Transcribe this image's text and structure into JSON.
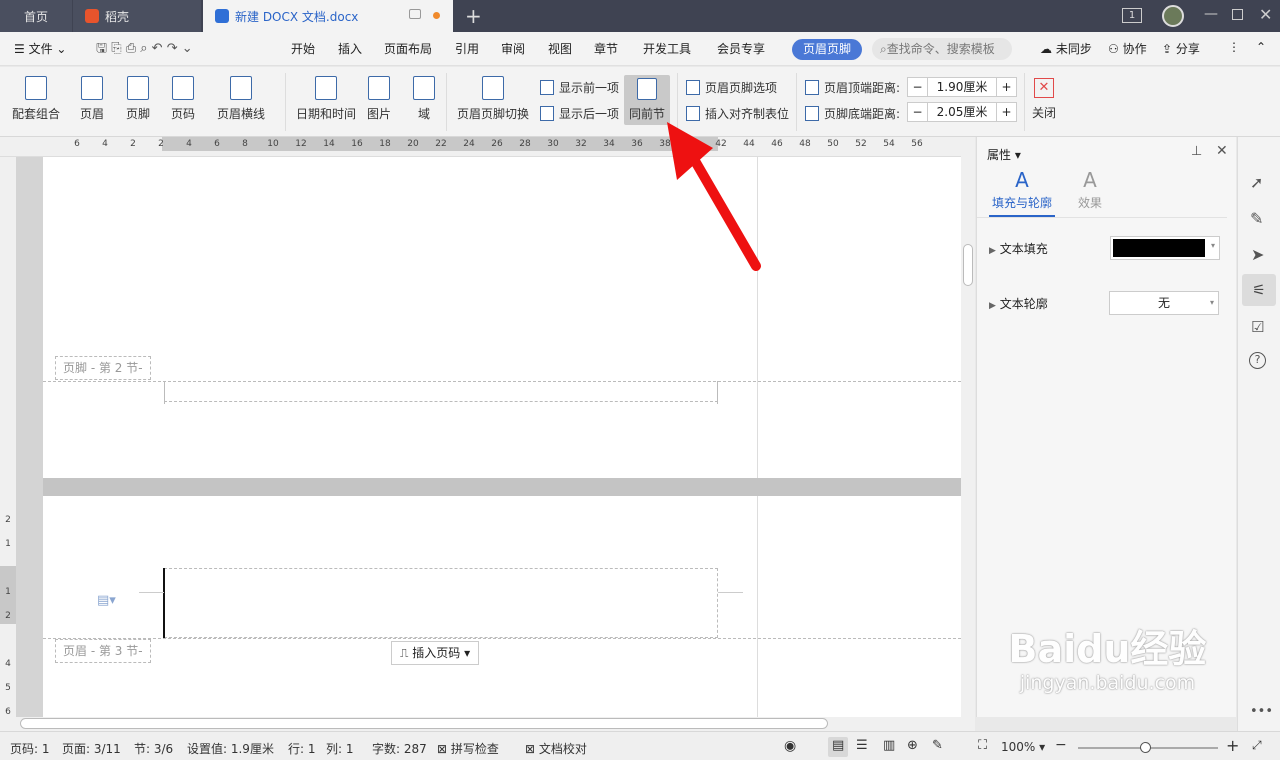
{
  "tabs": {
    "home": "首页",
    "daoke": "稻壳",
    "doc": "新建 DOCX 文档.docx",
    "page_num": "1"
  },
  "menu": {
    "file": "文件",
    "items": [
      "开始",
      "插入",
      "页面布局",
      "引用",
      "审阅",
      "视图",
      "章节",
      "开发工具",
      "会员专享"
    ],
    "active_tab": "页眉页脚",
    "search_placeholder": "查找命令、搜索模板",
    "unsync": "未同步",
    "collab": "协作",
    "share": "分享"
  },
  "ribbon": {
    "combo": "配套组合",
    "header": "页眉",
    "footer": "页脚",
    "page_number": "页码",
    "header_line": "页眉横线",
    "datetime": "日期和时间",
    "picture": "图片",
    "field": "域",
    "switch": "页眉页脚切换",
    "show_prev": "显示前一项",
    "show_next": "显示后一项",
    "same_as_prev": "同前节",
    "options": "页眉页脚选项",
    "insert_tab": "插入对齐制表位",
    "header_top": "页眉顶端距离:",
    "header_top_val": "1.90厘米",
    "footer_bottom": "页脚底端距离:",
    "footer_bottom_val": "2.05厘米",
    "close": "关闭"
  },
  "ruler_ticks": [
    "6",
    "4",
    "2",
    "2",
    "4",
    "6",
    "8",
    "10",
    "12",
    "14",
    "16",
    "18",
    "20",
    "22",
    "24",
    "26",
    "28",
    "30",
    "32",
    "34",
    "36",
    "38",
    "40",
    "42",
    "44",
    "46",
    "48",
    "50",
    "52",
    "54",
    "56"
  ],
  "vruler_ticks": [
    "2",
    "1",
    "1",
    "2",
    "4",
    "5",
    "6"
  ],
  "doc": {
    "footer_label": "页脚 - 第 2 节-",
    "header_label": "页眉 - 第 3 节-",
    "insert_page_num": "插入页码"
  },
  "panel": {
    "title": "属性",
    "tab_fill": "填充与轮廓",
    "tab_effect": "效果",
    "text_fill": "文本填充",
    "text_outline": "文本轮廓",
    "outline_value": "无",
    "fill_color": "#000000"
  },
  "status": {
    "page_code": "页码: 1",
    "page": "页面: 3/11",
    "section": "节: 3/6",
    "setting": "设置值: 1.9厘米",
    "row": "行: 1",
    "col": "列: 1",
    "words": "字数: 287",
    "spell": "拼写检查",
    "proof": "文档校对",
    "zoom": "100%"
  },
  "watermark": {
    "brand": "Baidu经验",
    "url": "jingyan.baidu.com"
  },
  "colors": {
    "accent": "#4a78d6",
    "arrow": "#ee1111"
  }
}
